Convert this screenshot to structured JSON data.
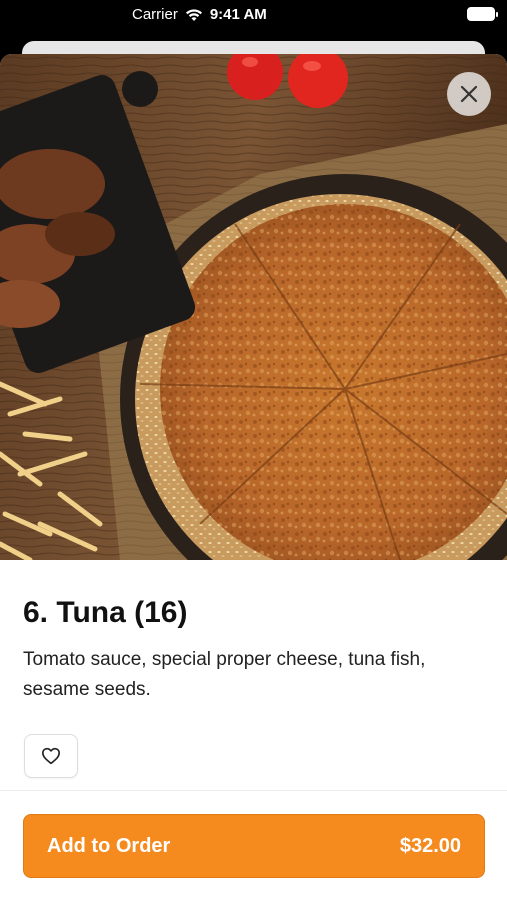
{
  "status_bar": {
    "carrier": "Carrier",
    "time": "9:41 AM"
  },
  "product": {
    "title": "6. Tuna (16)",
    "description": "Tomato sauce, special proper cheese, tuna fish, sesame seeds.",
    "image_subject": "tuna pizza on wooden board"
  },
  "actions": {
    "close_icon": "close-icon",
    "favorite_icon": "heart-icon",
    "add_label": "Add to Order",
    "price": "$32.00"
  },
  "colors": {
    "accent": "#f58a1f",
    "text_primary": "#111111"
  }
}
